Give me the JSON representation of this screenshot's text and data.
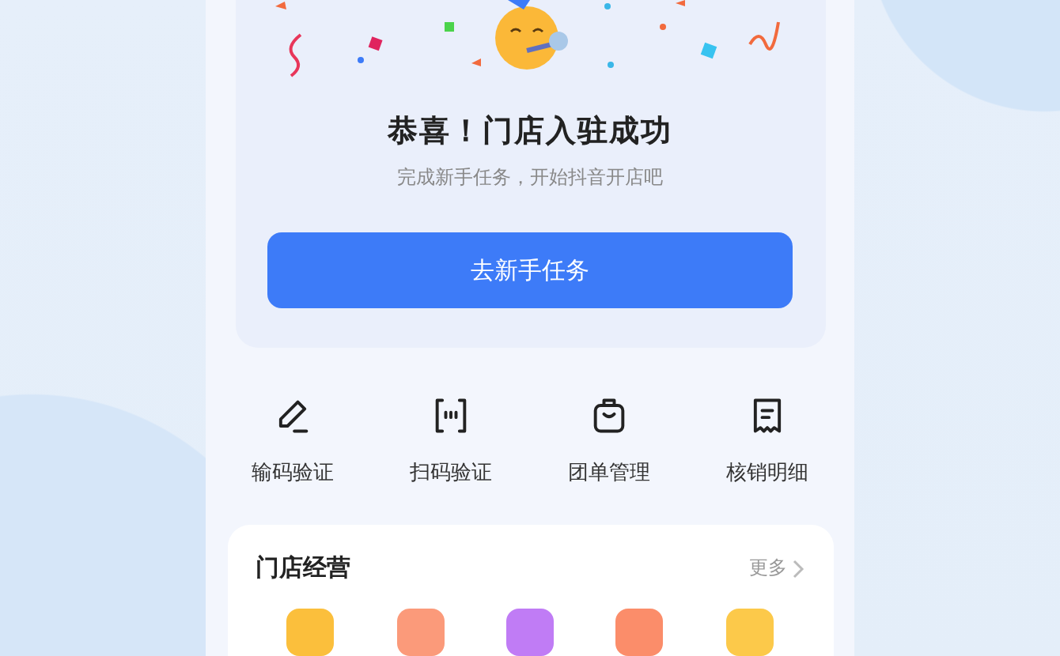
{
  "banner": {
    "title": "恭喜！门店入驻成功",
    "subtitle": "完成新手任务，开始抖音开店吧",
    "button": "去新手任务"
  },
  "shortcuts": [
    {
      "kind": "pencil",
      "label": "输码验证"
    },
    {
      "kind": "scan",
      "label": "扫码验证"
    },
    {
      "kind": "bag",
      "label": "团单管理"
    },
    {
      "kind": "receipt",
      "label": "核销明细"
    }
  ],
  "store_section": {
    "title": "门店经营",
    "more": "更多",
    "tiles": [
      {
        "color": "#fbbf3c"
      },
      {
        "color": "#fb9a7a"
      },
      {
        "color": "#c07cf5"
      },
      {
        "color": "#fb8d6a"
      },
      {
        "color": "#fcc94a"
      }
    ]
  }
}
